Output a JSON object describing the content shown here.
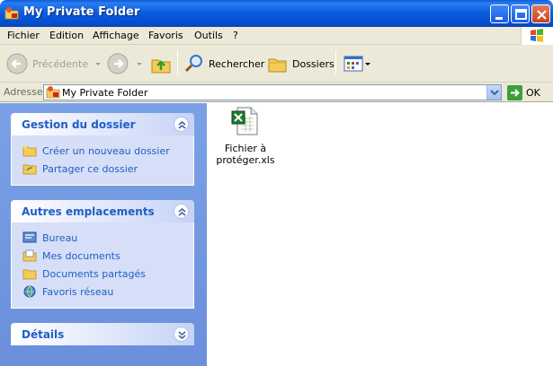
{
  "window": {
    "title": "My Private Folder"
  },
  "menu": {
    "items": [
      "Fichier",
      "Edition",
      "Affichage",
      "Favoris",
      "Outils",
      "?"
    ]
  },
  "toolbar": {
    "back_label": "Précédente",
    "search_label": "Rechercher",
    "folders_label": "Dossiers"
  },
  "address": {
    "label": "Adresse",
    "value": "My Private Folder",
    "go_label": "OK"
  },
  "panels": {
    "tasks": {
      "title": "Gestion du dossier",
      "items": [
        "Créer un nouveau dossier",
        "Partager ce dossier"
      ]
    },
    "places": {
      "title": "Autres emplacements",
      "items": [
        "Bureau",
        "Mes documents",
        "Documents partagés",
        "Favoris réseau"
      ]
    },
    "details": {
      "title": "Détails"
    }
  },
  "files": [
    {
      "name": "Fichier à protéger.xls",
      "icon": "excel-file-icon"
    }
  ],
  "colors": {
    "titlebar": "#0450d2",
    "panel_text": "#215dc6",
    "pane_bg": "#6b8fdc"
  }
}
